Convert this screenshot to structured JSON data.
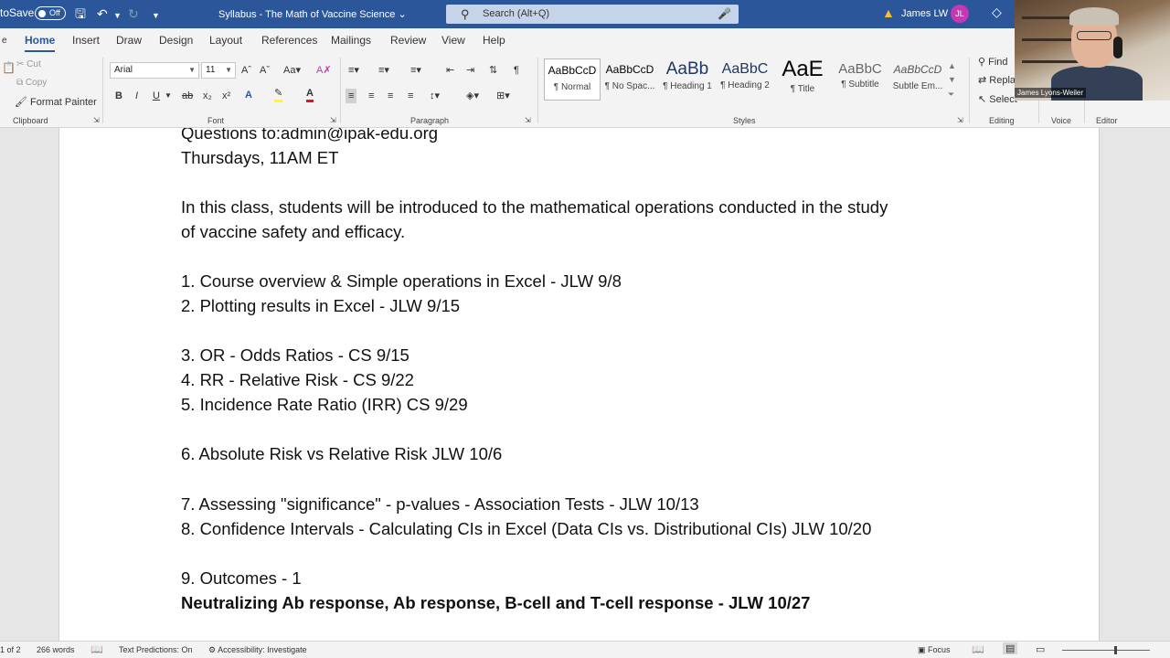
{
  "titlebar": {
    "autosave_label": "toSave",
    "autosave_state": "Off",
    "doc_title": "Syllabus - The Math of Vaccine Science",
    "search_placeholder": "Search (Alt+Q)",
    "user_name": "James LW",
    "user_initials": "JL"
  },
  "tabs": [
    "Home",
    "Insert",
    "Draw",
    "Design",
    "Layout",
    "References",
    "Mailings",
    "Review",
    "View",
    "Help"
  ],
  "ribbon": {
    "clipboard": {
      "cut": "Cut",
      "copy": "Copy",
      "format_painter": "Format Painter",
      "label": "Clipboard"
    },
    "font": {
      "name": "Arial",
      "size": "11",
      "label": "Font"
    },
    "paragraph": {
      "label": "Paragraph"
    },
    "styles": {
      "label": "Styles",
      "items": [
        {
          "sample": "AaBbCcD",
          "name": "¶ Normal"
        },
        {
          "sample": "AaBbCcD",
          "name": "¶ No Spac..."
        },
        {
          "sample": "AaBb",
          "name": "¶ Heading 1"
        },
        {
          "sample": "AaBbC",
          "name": "¶ Heading 2"
        },
        {
          "sample": "AaE",
          "name": "¶ Title"
        },
        {
          "sample": "AaBbC",
          "name": "¶ Subtitle"
        },
        {
          "sample": "AaBbCcD",
          "name": "Subtle Em..."
        }
      ]
    },
    "editing": {
      "find": "Find",
      "replace": "Repla",
      "select": "Select",
      "label": "Editing"
    },
    "voice": {
      "label": "Voice"
    },
    "editor": {
      "label": "Editor"
    }
  },
  "webcam": {
    "name": "James Lyons-Weiler"
  },
  "document": {
    "lines": [
      "Questions to:admin@ipak-edu.org",
      "Thursdays, 11AM ET",
      "In this class, students will be introduced to the mathematical operations conducted in the study",
      "of vaccine safety and efficacy.",
      "1. Course overview & Simple operations in Excel - JLW 9/8",
      "2. Plotting results in Excel - JLW 9/15",
      "3. OR - Odds Ratios - CS 9/15",
      "4. RR - Relative Risk - CS 9/22",
      "5. Incidence Rate Ratio (IRR) CS 9/29",
      "6. Absolute Risk vs Relative Risk JLW 10/6",
      "7. Assessing \"significance\" - p-values - Association Tests - JLW 10/13",
      "8. Confidence Intervals - Calculating CIs in Excel (Data CIs vs. Distributional CIs) JLW 10/20",
      "9. Outcomes - 1",
      "Neutralizing Ab response, Ab response, B-cell and T-cell response - JLW 10/27"
    ]
  },
  "status": {
    "page": "1 of 2",
    "words": "266 words",
    "text_predictions": "Text Predictions: On",
    "accessibility": "Accessibility: Investigate",
    "focus": "Focus"
  },
  "colors": {
    "brand": "#2b579a",
    "font_color": "#e81123",
    "highlight": "#ffff00"
  }
}
